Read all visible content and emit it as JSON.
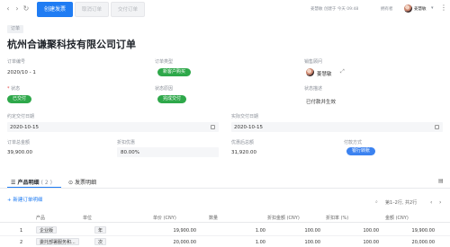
{
  "toolbar": {
    "create_return": "创建发票",
    "cancel_order": "取消订单",
    "deliver_order": "交付订单",
    "created_by": "姜慧敏",
    "created_label": "创建于",
    "created_time": "今天 09:48",
    "owner_label": "拥有者",
    "owner_name": "姜慧敏"
  },
  "header": {
    "tag": "订单",
    "title": "杭州合谦聚科技有限公司订单"
  },
  "fields": {
    "order_no_label": "订单编号",
    "order_no": "2020/10 - 1",
    "order_type_label": "订单类型",
    "order_type": "新客户购买",
    "sales_label": "销售顾问",
    "sales_name": "姜慧敏",
    "status_label": "状态",
    "status": "已交付",
    "status_reason_label": "状态原因",
    "status_reason": "完成交付",
    "status_desc_label": "状态描述",
    "status_desc": "已付款并生效",
    "planned_date_label": "约定交付日期",
    "planned_date": "2020-10-15",
    "actual_date_label": "实际交付日期",
    "actual_date": "2020-10-15",
    "total_label": "订单总金额",
    "total": "39,900.00",
    "discount_label": "折扣优惠",
    "discount": "80.00%",
    "discounted_total_label": "优惠后总额",
    "discounted_total": "31,920.00",
    "payment_label": "付款方式",
    "payment": "银行转账"
  },
  "tabs": {
    "products": "产品明细",
    "products_count": "( 2 )",
    "invoices": "发票明细"
  },
  "table": {
    "add_row": "+ 新建订单明细",
    "pager": "第1–2行, 共2行",
    "headers": {
      "product": "产品",
      "unit": "单位",
      "unit_price": "单价 (CNY)",
      "qty": "数量",
      "discount_amount": "折扣金额 (CNY)",
      "discount_rate": "折扣率 (%)",
      "amount": "金额 (CNY)"
    },
    "rows": [
      {
        "idx": "1",
        "product": "企业版",
        "unit": "年",
        "unit_price": "19,900.00",
        "qty": "1.00",
        "discount_amount": "100.00",
        "discount_rate": "100.00",
        "amount": "19,900.00"
      },
      {
        "idx": "2",
        "product": "委托部署服务和...",
        "unit": "次",
        "unit_price": "20,000.00",
        "qty": "1.00",
        "discount_amount": "100.00",
        "discount_rate": "100.00",
        "amount": "20,000.00"
      }
    ]
  },
  "colors": {
    "primary": "#1f7cf3",
    "status_green": "#2ea84a",
    "tag_blue": "#3b82f0"
  }
}
